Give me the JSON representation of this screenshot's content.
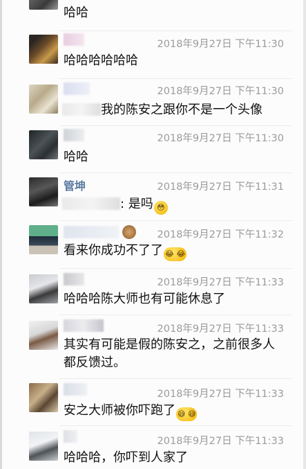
{
  "messages": [
    {
      "text": "哈哈"
    },
    {
      "time": "2018年9月27日 下午11:30",
      "text": "哈哈哈哈哈哈"
    },
    {
      "time": "2018年9月27日 下午11:30",
      "text": "我的陈安之跟你不是一个头像"
    },
    {
      "time": "2018年9月27日 下午11:30",
      "text": "哈哈"
    },
    {
      "name": "管坤",
      "time": "2018年9月27日 下午11:31",
      "text": ": 是吗",
      "emoji": "😳"
    },
    {
      "time": "2018年9月27日 下午11:32",
      "text": "看来你成功不了了",
      "emoji": "😂 😂"
    },
    {
      "time": "2018年9月27日 下午11:33",
      "text": "哈哈哈陈大师也有可能休息了"
    },
    {
      "time": "2018年9月27日 下午11:33",
      "text": "其实有可能是假的陈安之，之前很多人都反馈过。"
    },
    {
      "time": "2018年9月27日 下午11:33",
      "text": "安之大师被你吓跑了",
      "emoji": "😅 😅"
    },
    {
      "time": "2018年9月27日 下午11:33",
      "text": "哈哈哈，你吓到人家了"
    }
  ]
}
